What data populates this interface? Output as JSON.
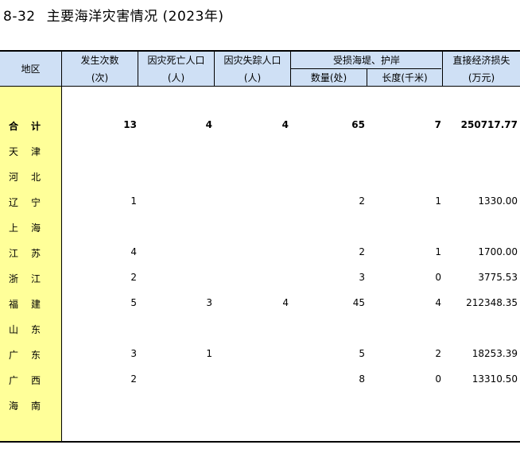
{
  "title": {
    "number": "8-32",
    "text": "主要海洋灾害情况 (2023年)"
  },
  "headers": {
    "region": "地区",
    "occurrences": {
      "label": "发生次数",
      "unit": "(次)"
    },
    "deaths": {
      "label": "因灾死亡人口",
      "unit": "(人)"
    },
    "missing": {
      "label": "因灾失踪人口",
      "unit": "(人)"
    },
    "seawall": {
      "label": "受损海堤、护岸",
      "count": "数量(处)",
      "length": "长度(千米)"
    },
    "loss": {
      "label": "直接经济损失",
      "unit": "(万元)"
    }
  },
  "rows": [
    {
      "name": [
        "合",
        "计"
      ],
      "values": [
        "13",
        "4",
        "4",
        "65",
        "7",
        "250717.77"
      ]
    },
    {
      "name": [
        "天",
        "津"
      ],
      "values": [
        "",
        "",
        "",
        "",
        "",
        ""
      ]
    },
    {
      "name": [
        "河",
        "北"
      ],
      "values": [
        "",
        "",
        "",
        "",
        "",
        ""
      ]
    },
    {
      "name": [
        "辽",
        "宁"
      ],
      "values": [
        "1",
        "",
        "",
        "2",
        "1",
        "1330.00"
      ]
    },
    {
      "name": [
        "上",
        "海"
      ],
      "values": [
        "",
        "",
        "",
        "",
        "",
        ""
      ]
    },
    {
      "name": [
        "江",
        "苏"
      ],
      "values": [
        "4",
        "",
        "",
        "2",
        "1",
        "1700.00"
      ]
    },
    {
      "name": [
        "浙",
        "江"
      ],
      "values": [
        "2",
        "",
        "",
        "3",
        "0",
        "3775.53"
      ]
    },
    {
      "name": [
        "福",
        "建"
      ],
      "values": [
        "5",
        "3",
        "4",
        "45",
        "4",
        "212348.35"
      ]
    },
    {
      "name": [
        "山",
        "东"
      ],
      "values": [
        "",
        "",
        "",
        "",
        "",
        ""
      ]
    },
    {
      "name": [
        "广",
        "东"
      ],
      "values": [
        "3",
        "1",
        "",
        "5",
        "2",
        "18253.39"
      ]
    },
    {
      "name": [
        "广",
        "西"
      ],
      "values": [
        "2",
        "",
        "",
        "8",
        "0",
        "13310.50"
      ]
    },
    {
      "name": [
        "海",
        "南"
      ],
      "values": [
        "",
        "",
        "",
        "",
        "",
        ""
      ]
    }
  ]
}
